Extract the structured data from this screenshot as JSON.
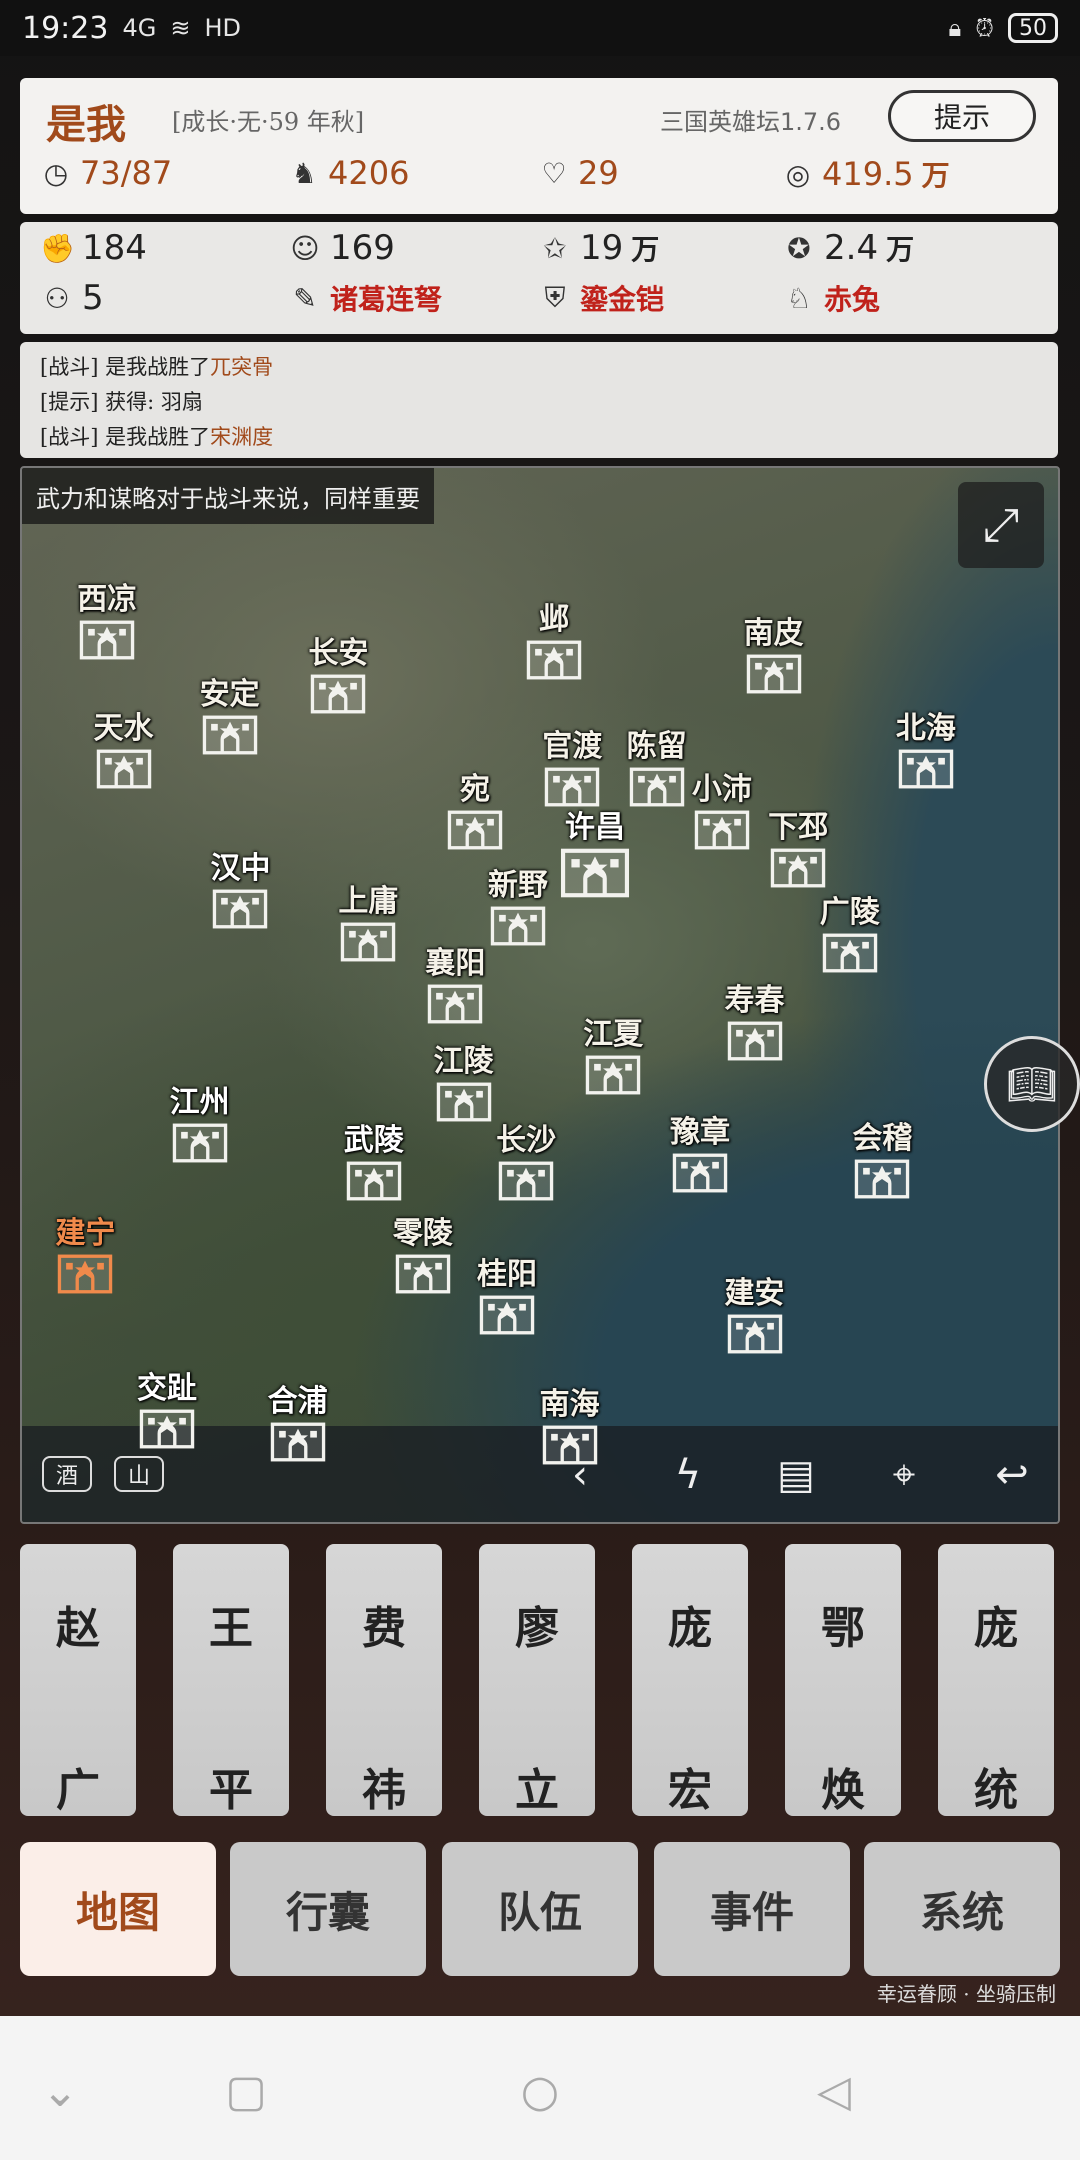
{
  "status_bar": {
    "time": "19:23",
    "signal": "4G",
    "network": "HD",
    "battery": "50"
  },
  "header": {
    "name": "是我",
    "subtitle": "[成长·无·59 年秋]",
    "version": "三国英雄坛1.7.6",
    "hint_button": "提示",
    "stats": [
      {
        "icon": "clock-icon",
        "glyph": "◷",
        "value": "73/87",
        "unit": ""
      },
      {
        "icon": "horse-icon",
        "glyph": "♞",
        "value": "4206",
        "unit": ""
      },
      {
        "icon": "heart-icon",
        "glyph": "♡",
        "value": "29",
        "unit": ""
      },
      {
        "icon": "coin-icon",
        "glyph": "◎",
        "value": "419.5",
        "unit": "万"
      }
    ]
  },
  "attributes": {
    "row1": [
      {
        "icon": "strength-icon",
        "glyph": "✊",
        "value": "184",
        "unit": ""
      },
      {
        "icon": "mind-icon",
        "glyph": "☺",
        "value": "169",
        "unit": ""
      },
      {
        "icon": "star-icon",
        "glyph": "✩",
        "value": "19",
        "unit": "万"
      },
      {
        "icon": "medal-icon",
        "glyph": "✪",
        "value": "2.4",
        "unit": "万"
      }
    ],
    "row2": [
      {
        "icon": "people-icon",
        "glyph": "⚇",
        "value": "5"
      },
      {
        "icon": "crossbow-icon",
        "glyph": "✎",
        "value": "诸葛连弩"
      },
      {
        "icon": "armor-icon",
        "glyph": "⛨",
        "value": "鎏金铠"
      },
      {
        "icon": "steed-icon",
        "glyph": "♘",
        "value": "赤兔"
      }
    ]
  },
  "log": [
    {
      "tag": "[战斗]",
      "text": "是我战胜了",
      "highlight": "兀突骨"
    },
    {
      "tag": "[提示]",
      "text": "获得: 羽扇",
      "highlight": ""
    },
    {
      "tag": "[战斗]",
      "text": "是我战胜了",
      "highlight": "宋渊度"
    }
  ],
  "map": {
    "tip": "武力和谋略对于战斗来说，同样重要",
    "cities": [
      {
        "name": "西凉"
      },
      {
        "name": "长安"
      },
      {
        "name": "邺"
      },
      {
        "name": "南皮"
      },
      {
        "name": "安定"
      },
      {
        "name": "天水"
      },
      {
        "name": "官渡"
      },
      {
        "name": "陈留"
      },
      {
        "name": "北海"
      },
      {
        "name": "宛"
      },
      {
        "name": "小沛"
      },
      {
        "name": "许昌"
      },
      {
        "name": "下邳"
      },
      {
        "name": "汉中"
      },
      {
        "name": "上庸"
      },
      {
        "name": "新野"
      },
      {
        "name": "广陵"
      },
      {
        "name": "襄阳"
      },
      {
        "name": "寿春"
      },
      {
        "name": "江夏"
      },
      {
        "name": "江陵"
      },
      {
        "name": "江州"
      },
      {
        "name": "武陵"
      },
      {
        "name": "长沙"
      },
      {
        "name": "豫章"
      },
      {
        "name": "会稽"
      },
      {
        "name": "建宁"
      },
      {
        "name": "零陵"
      },
      {
        "name": "桂阳"
      },
      {
        "name": "建安"
      },
      {
        "name": "交趾"
      },
      {
        "name": "合浦"
      },
      {
        "name": "南海"
      }
    ],
    "toolbar": {
      "tag1": "酒",
      "tag2": "山"
    }
  },
  "heroes": [
    {
      "top": "赵",
      "bottom": "广"
    },
    {
      "top": "王",
      "bottom": "平"
    },
    {
      "top": "费",
      "bottom": "祎"
    },
    {
      "top": "廖",
      "bottom": "立"
    },
    {
      "top": "庞",
      "bottom": "宏"
    },
    {
      "top": "鄂",
      "bottom": "焕"
    },
    {
      "top": "庞",
      "bottom": "统"
    }
  ],
  "tabs": [
    {
      "label": "地图",
      "active": true
    },
    {
      "label": "行囊",
      "active": false
    },
    {
      "label": "队伍",
      "active": false
    },
    {
      "label": "事件",
      "active": false
    },
    {
      "label": "系统",
      "active": false
    }
  ],
  "motto": "幸运眷顾 · 坐骑压制",
  "colors": {
    "accent": "#a14a1b",
    "equipment": "#c0221b",
    "player_city": "#f08a4b"
  }
}
